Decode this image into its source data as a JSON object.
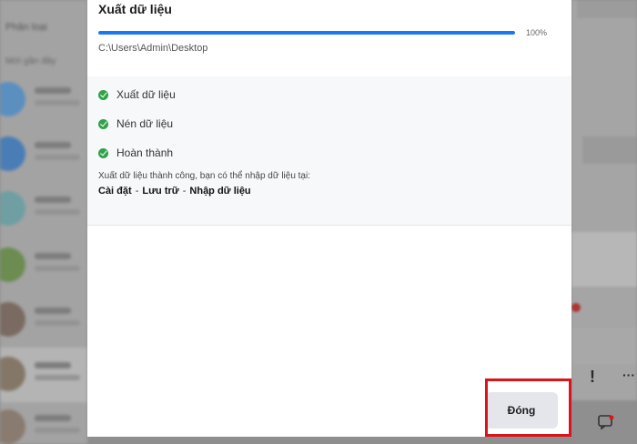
{
  "background": {
    "left_header": "Phân loại",
    "left_subheader": "Mới gần đây",
    "right_icons": [
      "!",
      "···"
    ]
  },
  "dialog": {
    "title": "Xuất dữ liệu",
    "progress_percent": 100,
    "progress_label": "100%",
    "path": "C:\\Users\\Admin\\Desktop",
    "steps": [
      {
        "label": "Xuất dữ liệu",
        "status": "done"
      },
      {
        "label": "Nén dữ liệu",
        "status": "done"
      },
      {
        "label": "Hoàn thành",
        "status": "done"
      }
    ],
    "success_message": "Xuất dữ liệu thành công, bạn có thể nhập dữ liệu tại:",
    "nav_path": [
      "Cài đặt",
      "Lưu trữ",
      "Nhập dữ liệu"
    ],
    "nav_separator": "-",
    "close_label": "Đóng"
  },
  "colors": {
    "progress": "#1877f2",
    "check": "#31a24c",
    "highlight": "#d9141b"
  }
}
